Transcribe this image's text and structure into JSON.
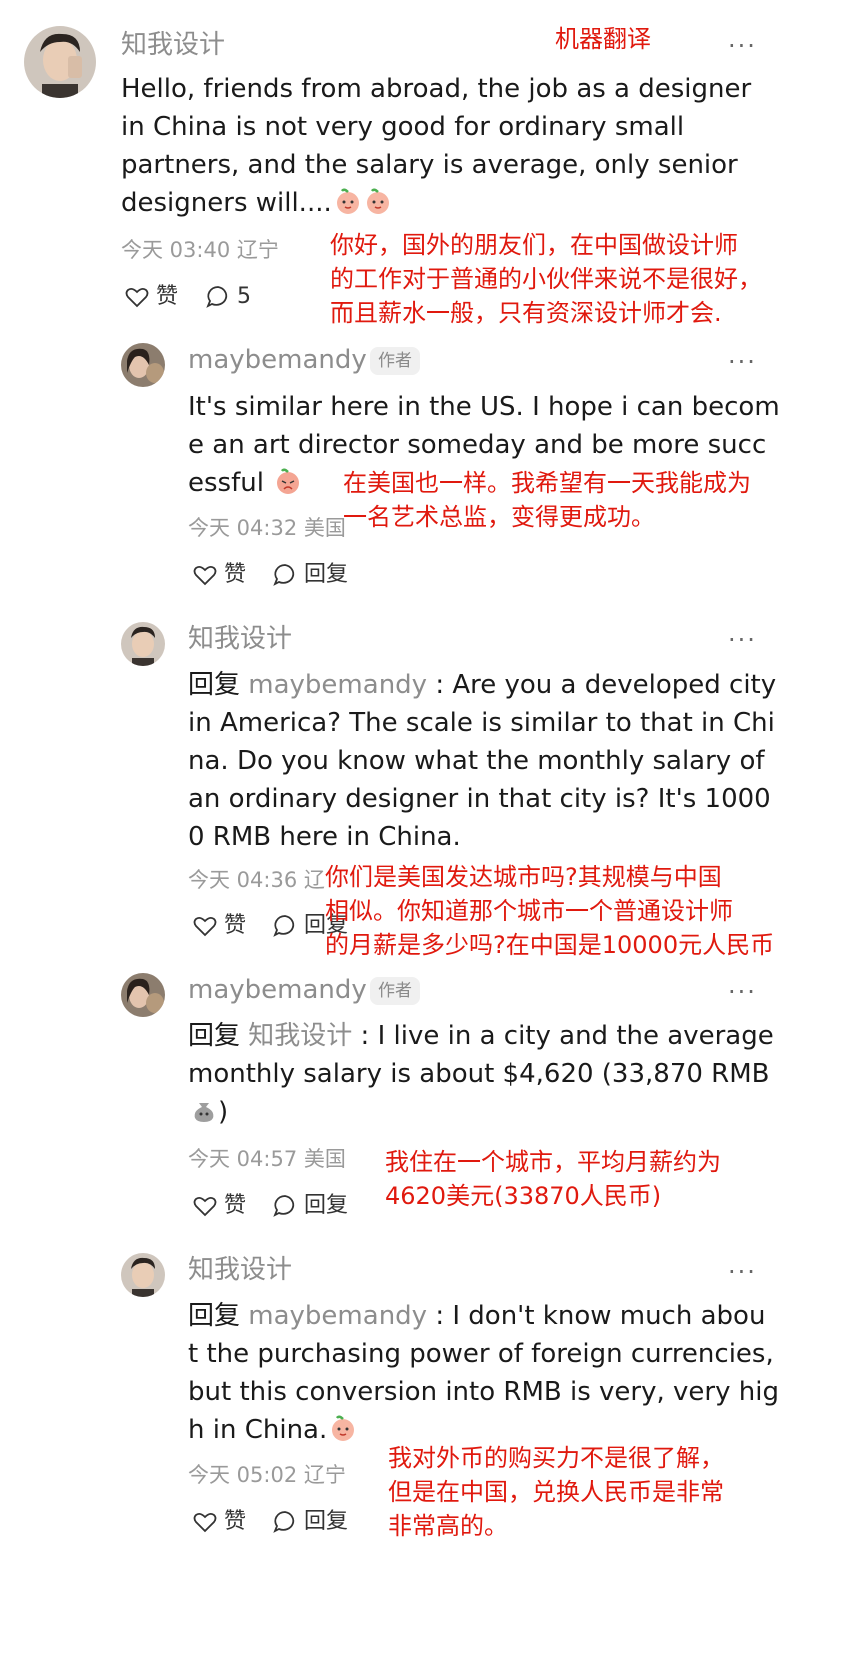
{
  "colors": {
    "translation_red": "#e0190e",
    "username_gray": "#8d8d8d",
    "meta_gray": "#9a9a9a"
  },
  "top_label": "机器翻译",
  "more_label": "···",
  "author_tag": "作者",
  "like_label": "赞",
  "reply_label": "回复",
  "main_comment": {
    "username": "知我设计",
    "lines": [
      "Hello, friends from abroad, the job as a designer",
      "in China is not very good for ordinary small",
      "partners, and the salary is average, only senior",
      "designers will...."
    ],
    "time": "今天 03:40",
    "location": "辽宁",
    "reply_count": "5",
    "translation": [
      "你好，国外的朋友们，在中国做设计师",
      "的工作对于普通的小伙伴来说不是很好，",
      "而且薪水一般，只有资深设计师才会."
    ]
  },
  "replies": [
    {
      "username": "maybemandy",
      "lines": [
        "It's similar here in the US. I hope i can becom",
        "e an art director someday and be more succ",
        "essful"
      ],
      "time": "今天 04:32",
      "location": "美国",
      "translation": [
        "在美国也一样。我希望有一天我能成为",
        "一名艺术总监，变得更成功。"
      ]
    },
    {
      "username": "知我设计",
      "reply_prefix": "回复",
      "reply_target": "maybemandy",
      "lines": [
        " : Are you a developed city",
        "in America? The scale is similar to that in Chi",
        "na. Do you know what the monthly salary of",
        "an ordinary designer in that city is? It's 1000",
        "0 RMB here in China."
      ],
      "time": "今天 04:36",
      "location": "辽",
      "translation": [
        "你们是美国发达城市吗?其规模与中国",
        "相似。你知道那个城市一个普通设计师",
        "的月薪是多少吗?在中国是10000元人民币"
      ]
    },
    {
      "username": "maybemandy",
      "reply_prefix": "回复",
      "reply_target": "知我设计",
      "lines": [
        " : I live in a city and the average",
        "monthly salary is about $4,620 (33,870 RMB",
        ")"
      ],
      "time": "今天 04:57",
      "location": "美国",
      "translation": [
        "我住在一个城市，平均月薪约为",
        "4620美元(33870人民币)"
      ]
    },
    {
      "username": "知我设计",
      "reply_prefix": "回复",
      "reply_target": "maybemandy",
      "lines": [
        " : I don't know much abou",
        "t the purchasing power of foreign currencies,",
        "but this conversion into RMB is very, very hig",
        "h in China."
      ],
      "time": "今天 05:02",
      "location": "辽宁",
      "translation": [
        "我对外币的购买力不是很了解，",
        "但是在中国，兑换人民币是非常",
        "非常高的。"
      ]
    }
  ]
}
